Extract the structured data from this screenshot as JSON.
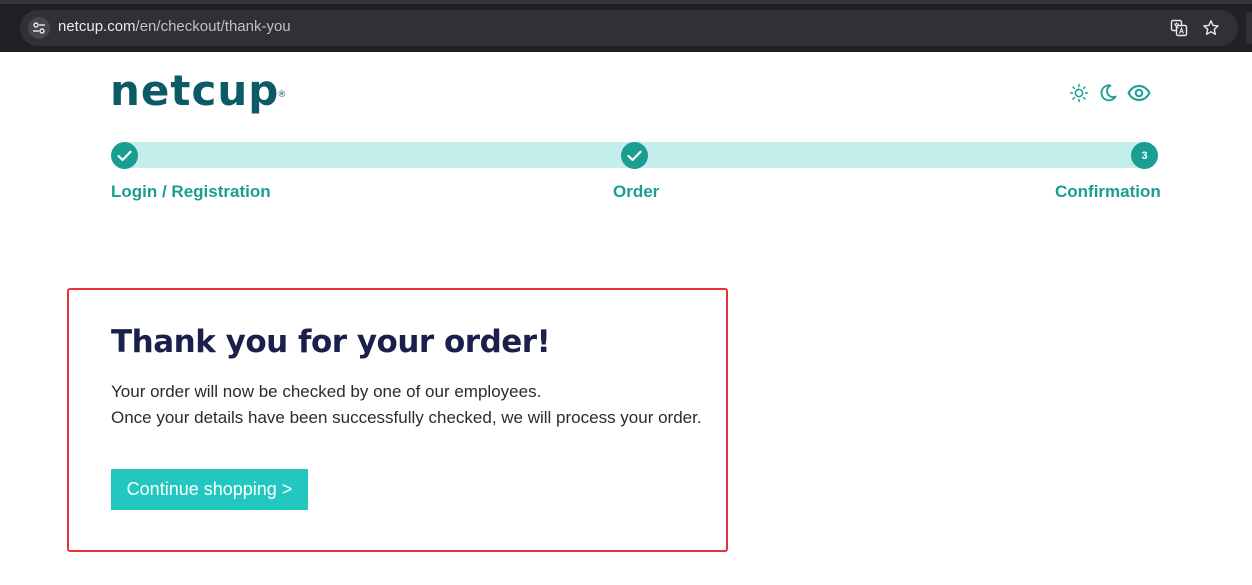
{
  "browser": {
    "url_host": "netcup.com",
    "url_path": "/en/checkout/thank-you",
    "icons": [
      "site-info-icon",
      "translate-icon",
      "star-icon"
    ]
  },
  "header": {
    "logo_text": "netcup",
    "logo_mark": "®",
    "mode_icons": [
      "sun-icon",
      "moon-icon",
      "eye-icon"
    ]
  },
  "progress": {
    "steps": [
      {
        "label": "Login / Registration",
        "status": "done"
      },
      {
        "label": "Order",
        "status": "done"
      },
      {
        "label": "Confirmation",
        "number": "3",
        "status": "current"
      }
    ]
  },
  "confirmation": {
    "title": "Thank you for your order!",
    "line1": "Your order will now be checked by one of our employees.",
    "line2": "Once your details have been successfully checked, we will process your order.",
    "continue_label": "Continue shopping >"
  },
  "colors": {
    "brand": "#0b5a66",
    "accent": "#1a9e92",
    "track": "#c4eeeb",
    "button": "#22c7c0",
    "highlight_border": "#ec2f34",
    "title": "#1b1f4b"
  }
}
